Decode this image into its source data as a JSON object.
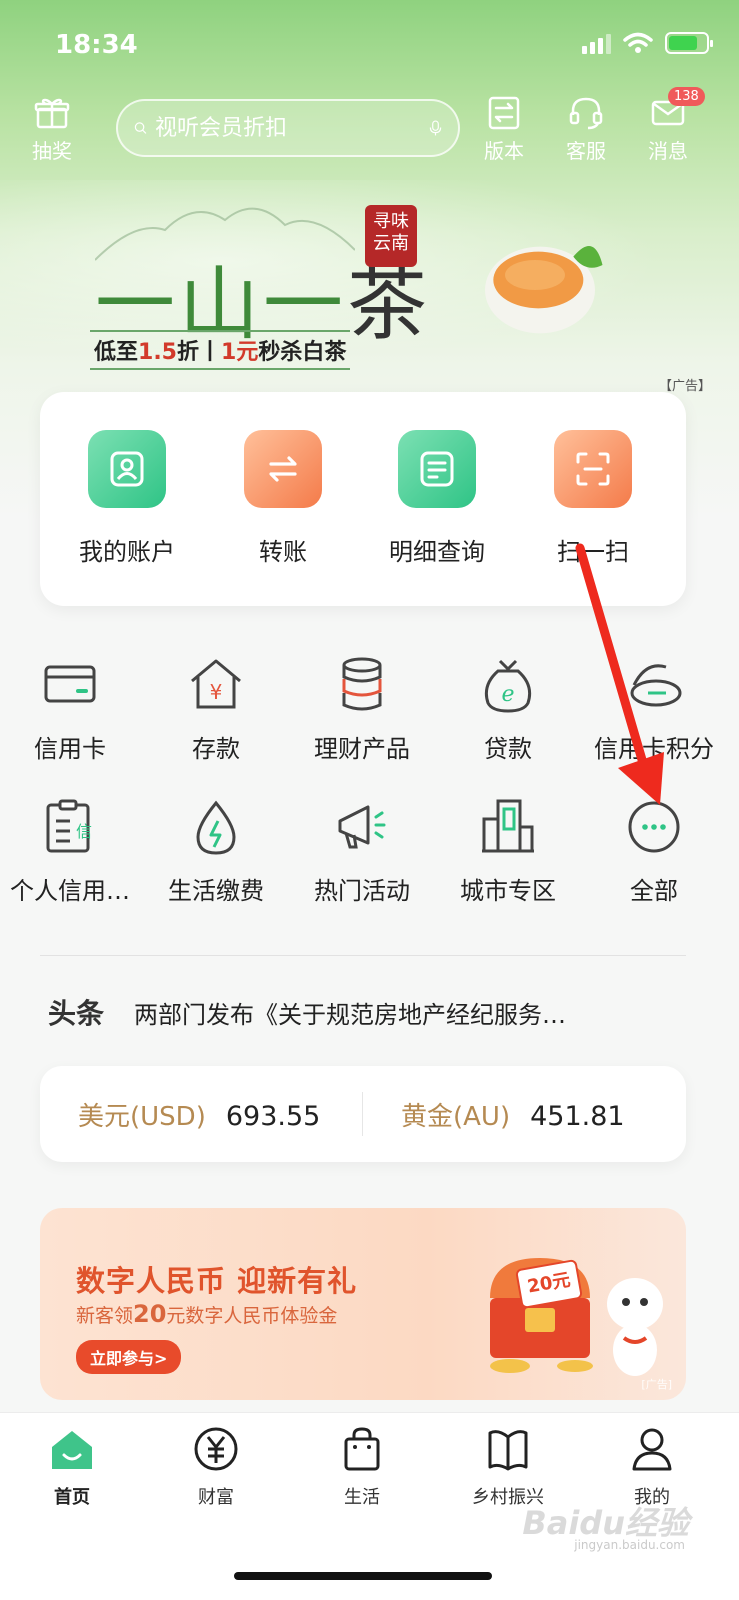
{
  "status_bar": {
    "time": "18:34"
  },
  "top_bar": {
    "lottery_label": "抽奖",
    "search_placeholder": "视听会员折扣",
    "version_label": "版本",
    "service_label": "客服",
    "message_label": "消息",
    "message_badge": "138"
  },
  "banner": {
    "title_a": "一山一",
    "title_b": "茶",
    "seal": "寻味云南",
    "sub_prefix": "低至",
    "sub_discount": "1.5",
    "sub_mid": "折丨",
    "sub_price": "1元",
    "sub_suffix": "秒杀白茶",
    "ad_tag": "【广告】"
  },
  "quick_actions": [
    {
      "label": "我的账户",
      "icon": "user-icon",
      "color": "green"
    },
    {
      "label": "转账",
      "icon": "transfer-icon",
      "color": "orange"
    },
    {
      "label": "明细查询",
      "icon": "detail-icon",
      "color": "green"
    },
    {
      "label": "扫一扫",
      "icon": "scan-icon",
      "color": "orange"
    }
  ],
  "services": [
    {
      "label": "信用卡",
      "icon": "credit-card-icon"
    },
    {
      "label": "存款",
      "icon": "deposit-icon"
    },
    {
      "label": "理财产品",
      "icon": "wealth-coins-icon"
    },
    {
      "label": "贷款",
      "icon": "loan-bag-icon"
    },
    {
      "label": "信用卡积分",
      "icon": "points-icon"
    },
    {
      "label": "个人信用…",
      "icon": "credit-report-icon"
    },
    {
      "label": "生活缴费",
      "icon": "water-drop-icon"
    },
    {
      "label": "热门活动",
      "icon": "megaphone-icon"
    },
    {
      "label": "城市专区",
      "icon": "city-building-icon"
    },
    {
      "label": "全部",
      "icon": "more-icon"
    }
  ],
  "headline": {
    "tag": "头条",
    "text": "两部门发布《关于规范房地产经纪服务…"
  },
  "rates": [
    {
      "name": "美元(USD)",
      "value": "693.55"
    },
    {
      "name": "黄金(AU)",
      "value": "451.81"
    }
  ],
  "promo": {
    "title": "数字人民币 迎新有礼",
    "sub_prefix": "新客领",
    "sub_amount": "20",
    "sub_suffix": "元数字人民币体验金",
    "button": "立即参与>",
    "coupon": "20元",
    "ad_tag": "[广告]"
  },
  "tabbar": [
    {
      "label": "首页",
      "icon": "home-icon",
      "active": true
    },
    {
      "label": "财富",
      "icon": "yuan-icon",
      "active": false
    },
    {
      "label": "生活",
      "icon": "shopping-bag-icon",
      "active": false
    },
    {
      "label": "乡村振兴",
      "icon": "book-icon",
      "active": false
    },
    {
      "label": "我的",
      "icon": "profile-icon",
      "active": false
    }
  ],
  "watermark": {
    "brand": "Baidu经验",
    "domain": "jingyan.baidu.com"
  },
  "colors": {
    "accent_green": "#3fc48a",
    "accent_orange": "#f47b4a",
    "gold_text": "#b58a52",
    "annotation_red": "#ee2a1e"
  }
}
